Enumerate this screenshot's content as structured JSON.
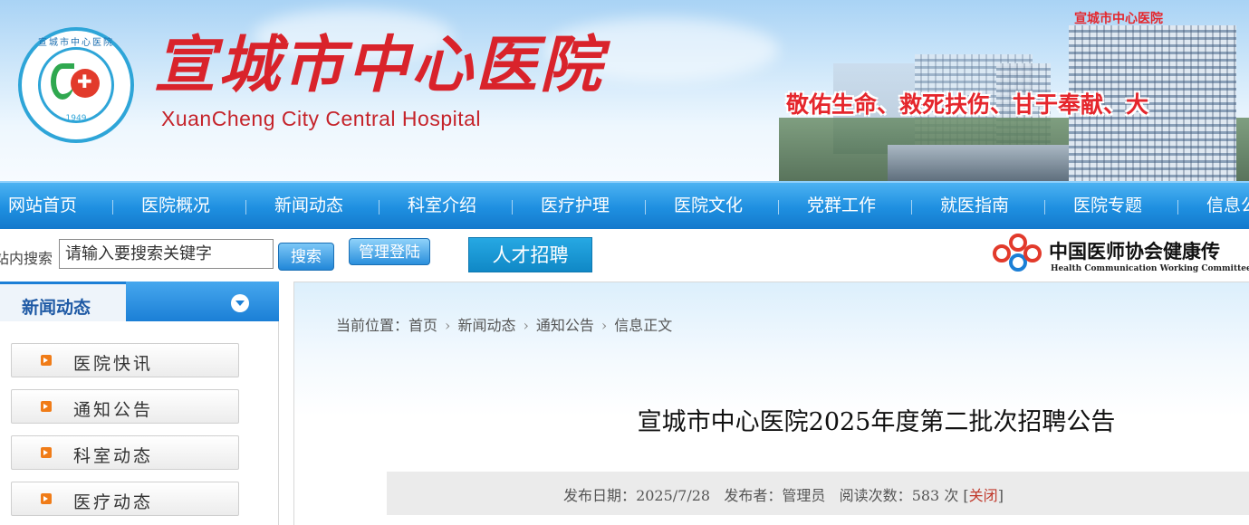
{
  "header": {
    "logo_ring_text": "宣城市中心医院",
    "logo_year": "1949",
    "hospital_name": "宣城市中心医院",
    "hospital_name_en": "XuanCheng City Central Hospital",
    "slogan": "敬佑生命、救死扶伤、甘于奉献、大",
    "building_sign": "宣城市中心医院"
  },
  "nav": {
    "items": [
      "网站首页",
      "医院概况",
      "新闻动态",
      "科室介绍",
      "医疗护理",
      "医院文化",
      "党群工作",
      "就医指南",
      "医院专题",
      "信息公"
    ]
  },
  "search": {
    "label": "站内搜索",
    "placeholder": "请输入要搜索关键字",
    "search_button": "搜索",
    "login_button": "管理登陆",
    "recruit_button": "人才招聘"
  },
  "association": {
    "title": "中国医师协会健康传",
    "subtitle": "Health Communication Working Committee M"
  },
  "sidebar": {
    "title": "新闻动态",
    "items": [
      "医院快讯",
      "通知公告",
      "科室动态",
      "医疗动态"
    ]
  },
  "breadcrumb": {
    "prefix": "当前位置：",
    "items": [
      "首页",
      "新闻动态",
      "通知公告",
      "信息正文"
    ]
  },
  "article": {
    "title": "宣城市中心医院2025年度第二批次招聘公告",
    "date_label": "发布日期：",
    "date": "2025/7/28",
    "author_label": "发布者：",
    "author": "管理员",
    "views_label": "阅读次数：",
    "views": "583",
    "views_unit": "次",
    "close_label": "关闭"
  },
  "colors": {
    "brand_red": "#d9232b",
    "nav_blue": "#1e8fe0",
    "accent_orange": "#f07c18"
  }
}
